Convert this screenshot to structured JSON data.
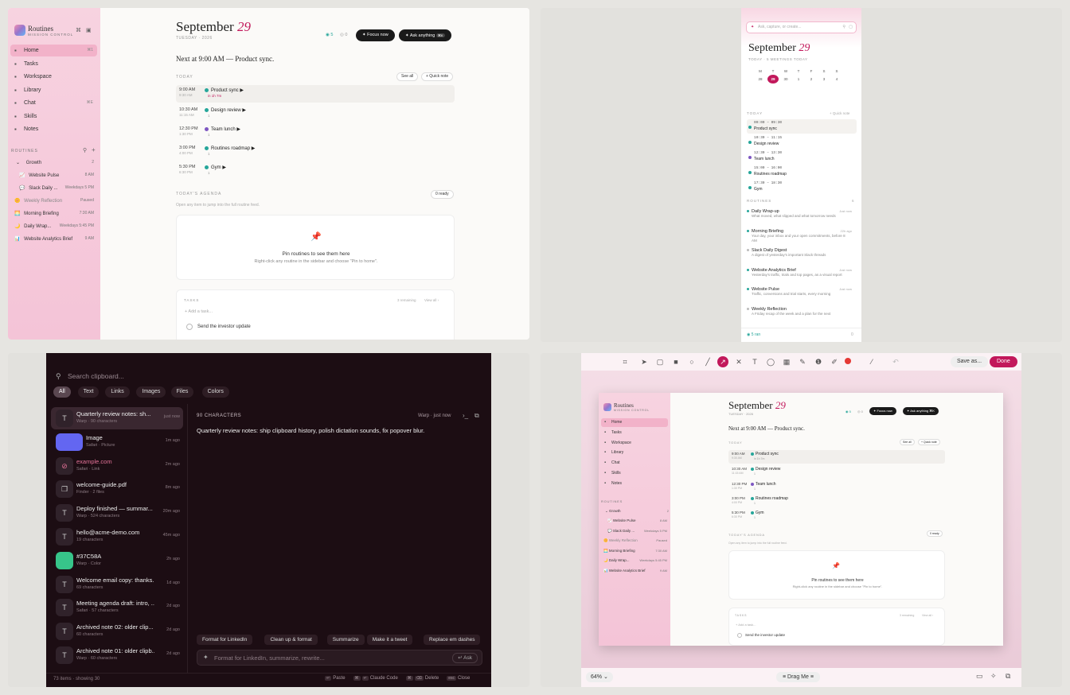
{
  "app": {
    "name": "Routines",
    "subtitle": "MISSION CONTROL"
  },
  "nav": [
    {
      "label": "Home",
      "icon": "home-icon",
      "shortcut": "⌘1",
      "active": true
    },
    {
      "label": "Tasks",
      "icon": "tasks-icon",
      "shortcut": ""
    },
    {
      "label": "Workspace",
      "icon": "workspace-icon",
      "shortcut": ""
    },
    {
      "label": "Library",
      "icon": "library-icon",
      "shortcut": ""
    },
    {
      "label": "Chat",
      "icon": "chat-icon",
      "shortcut": "⌘E"
    },
    {
      "label": "Skills",
      "icon": "skills-icon",
      "shortcut": ""
    },
    {
      "label": "Notes",
      "icon": "notes-icon",
      "shortcut": ""
    }
  ],
  "routines_section": {
    "label": "ROUTINES",
    "group": "Growth",
    "group_count": "2"
  },
  "routines": [
    {
      "name": "Website Pulse",
      "time": "8 AM",
      "emoji": "📈",
      "indent": true
    },
    {
      "name": "Slack Daily ...",
      "time": "Weekdays 5 PM",
      "emoji": "💬",
      "indent": true
    },
    {
      "name": "Weekly Reflection",
      "time": "Paused",
      "emoji": "🌼",
      "indent": false,
      "muted": true
    },
    {
      "name": "Morning Briefing",
      "time": "7:30 AM",
      "emoji": "🌅",
      "indent": false
    },
    {
      "name": "Daily Wrap...",
      "time": "Weekdays 5:45 PM",
      "emoji": "🌙",
      "indent": false
    },
    {
      "name": "Website Analytics Brief",
      "time": "9 AM",
      "emoji": "📊",
      "indent": false
    }
  ],
  "header": {
    "month": "September",
    "day": "29",
    "weekday": "TUESDAY · 2026",
    "done_count": "5",
    "open_count": "0",
    "focus_label": "Focus now",
    "ask_label": "Ask anything",
    "ask_kbd": "⌘K",
    "next_up": "Next at 9:00 AM — Product sync."
  },
  "today": {
    "label": "TODAY",
    "see_all": "See all",
    "quick_note": "+ Quick note"
  },
  "events": [
    {
      "time": "9:00 AM",
      "end": "9:30 AM",
      "name": "Product sync",
      "sub": "in 1h 7m",
      "color": "#26a69a"
    },
    {
      "time": "10:30 AM",
      "end": "11:15 AM",
      "name": "Design review",
      "sub": "1",
      "color": "#26a69a"
    },
    {
      "time": "12:30 PM",
      "end": "1:30 PM",
      "name": "Team lunch",
      "sub": "1",
      "color": "#7e57c2"
    },
    {
      "time": "3:00 PM",
      "end": "4:00 PM",
      "name": "Routines roadmap",
      "sub": "1",
      "color": "#26a69a"
    },
    {
      "time": "5:30 PM",
      "end": "6:30 PM",
      "name": "Gym",
      "sub": "1",
      "color": "#26a69a"
    }
  ],
  "agenda": {
    "label": "TODAY'S AGENDA",
    "ready": "0 ready",
    "hint": "Open any item to jump into the full routine feed.",
    "empty_title": "Pin routines to see them here",
    "empty_sub": "Right-click any routine in the sidebar and choose \"Pin to home\"."
  },
  "tasks": {
    "label": "TASKS",
    "remaining": "3 remaining",
    "view_all": "View all ›",
    "add": "+ Add a task...",
    "item": "Send the investor update"
  },
  "mobile": {
    "search_placeholder": "Ask, capture, or create...",
    "month": "September",
    "day": "29",
    "sub": "TODAY · 5 MEETINGS TODAY",
    "weekdays": [
      "M",
      "T",
      "W",
      "T",
      "F",
      "S",
      "S"
    ],
    "dates": [
      "28",
      "29",
      "30",
      "1",
      "2",
      "3",
      "4"
    ],
    "today_label": "TODAY",
    "quick_note": "+ Quick note",
    "events": [
      {
        "time": "09:00 – 09:30",
        "name": "Product sync",
        "color": "#26a69a"
      },
      {
        "time": "10:30 – 11:15",
        "name": "Design review",
        "color": "#26a69a"
      },
      {
        "time": "12:30 – 13:30",
        "name": "Team lunch",
        "color": "#7e57c2"
      },
      {
        "time": "15:00 – 16:00",
        "name": "Routines roadmap",
        "color": "#26a69a"
      },
      {
        "time": "17:30 – 18:30",
        "name": "Gym",
        "color": "#26a69a"
      }
    ],
    "routines_label": "ROUTINES",
    "routines_count": "6",
    "routines": [
      {
        "name": "Daily Wrap-up",
        "desc": "What moved, what slipped and what tomorrow needs",
        "time": "Just now",
        "color": "#26a69a"
      },
      {
        "name": "Morning Briefing",
        "desc": "Your day, your inbox and your open commitments, before 8 AM",
        "time": "22h ago",
        "color": "#26a69a"
      },
      {
        "name": "Slack Daily Digest",
        "desc": "A digest of yesterday's important Slack threads",
        "time": "",
        "color": "#bbb"
      },
      {
        "name": "Website Analytics Brief",
        "desc": "Yesterday's traffic, trials and top pages, as a visual report",
        "time": "Just now",
        "color": "#26a69a"
      },
      {
        "name": "Website Pulse",
        "desc": "Traffic, conversions and trial starts, every morning",
        "time": "Just now",
        "color": "#26a69a"
      },
      {
        "name": "Weekly Reflection",
        "desc": "A Friday recap of the week and a plan for the next",
        "time": "",
        "color": "#bbb"
      }
    ],
    "footer": "5 ran",
    "footer_count": "0"
  },
  "clipboard": {
    "search_placeholder": "Search clipboard...",
    "filters": [
      "All",
      "Text",
      "Links",
      "Images",
      "Files",
      "Colors"
    ],
    "items": [
      {
        "title": "Quarterly review notes: sh...",
        "sub": "Warp · 90 characters",
        "age": "just now",
        "icon": "T",
        "kind": "text"
      },
      {
        "title": "Image",
        "sub": "Safari · Picture",
        "age": "1m ago",
        "icon": "",
        "kind": "image",
        "color": "#6366f1"
      },
      {
        "title": "example.com",
        "sub": "Safari · Link",
        "age": "2m ago",
        "icon": "⊘",
        "kind": "link"
      },
      {
        "title": "welcome-guide.pdf",
        "sub": "Finder · 2 files",
        "age": "8m ago",
        "icon": "❐",
        "kind": "file"
      },
      {
        "title": "Deploy finished — summar...",
        "sub": "Warp · 524 characters",
        "age": "20m ago",
        "icon": "T",
        "kind": "text"
      },
      {
        "title": "hello@acme-demo.com",
        "sub": "19 characters",
        "age": "45m ago",
        "icon": "T",
        "kind": "text"
      },
      {
        "title": "#37C58A",
        "sub": "Warp · Color",
        "age": "2h ago",
        "icon": "",
        "kind": "color",
        "color": "#37C58A"
      },
      {
        "title": "Welcome email copy: thanks...",
        "sub": "69 characters",
        "age": "1d ago",
        "icon": "T",
        "kind": "text"
      },
      {
        "title": "Meeting agenda draft: intro, ...",
        "sub": "Safari · 57 characters",
        "age": "2d ago",
        "icon": "T",
        "kind": "text"
      },
      {
        "title": "Archived note 02: older clip...",
        "sub": "60 characters",
        "age": "2d ago",
        "icon": "T",
        "kind": "text"
      },
      {
        "title": "Archived note 01: older clipb...",
        "sub": "Warp · 60 characters",
        "age": "2d ago",
        "icon": "T",
        "kind": "text"
      }
    ],
    "detail_label": "90 CHARACTERS",
    "detail_source": "Warp · just now",
    "detail_text": "Quarterly review notes: ship clipboard history, polish dictation sounds, fix popover blur.",
    "actions": [
      "Format for LinkedIn",
      "Clean up & format",
      "Summarize",
      "Make it a tweet",
      "Replace em dashes"
    ],
    "ask_placeholder": "Format for LinkedIn, summarize, rewrite...",
    "ask_label": "Ask",
    "status": "73 items · showing 30",
    "shortcuts": [
      {
        "keys": [
          "↵"
        ],
        "label": "Paste"
      },
      {
        "keys": [
          "⌘",
          "↵"
        ],
        "label": "Claude Code"
      },
      {
        "keys": [
          "⌘",
          "⌫"
        ],
        "label": "Delete"
      },
      {
        "keys": [
          "esc"
        ],
        "label": "Close"
      }
    ]
  },
  "editor": {
    "save_as": "Save as...",
    "done": "Done",
    "zoom": "64%",
    "drag": "Drag Me",
    "accent": "#c2185b"
  }
}
